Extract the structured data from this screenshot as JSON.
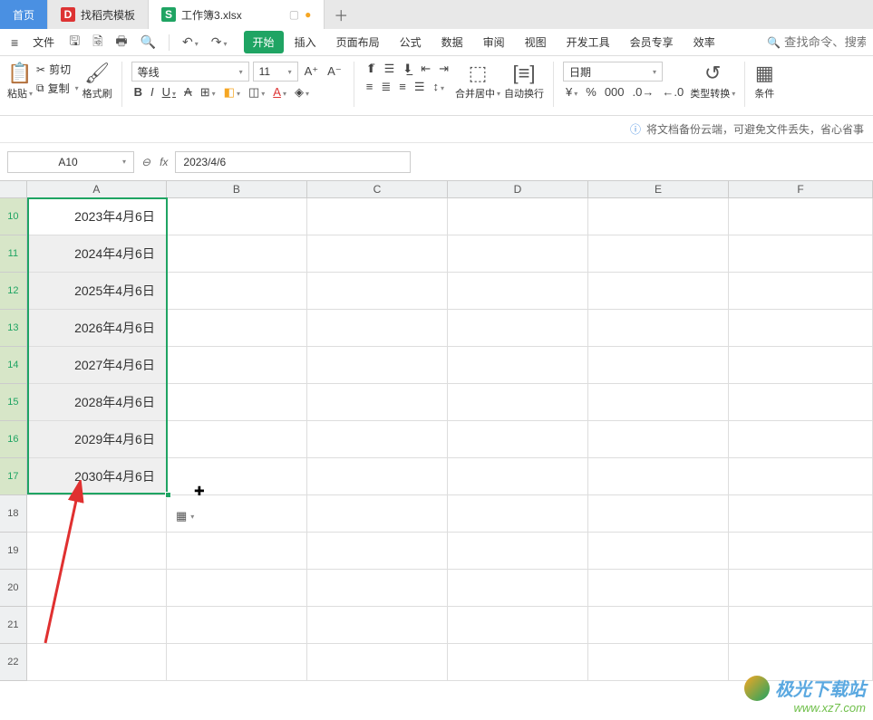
{
  "tabs": {
    "home": "首页",
    "docker_label": "找稻壳模板",
    "workbook_label": "工作簿3.xlsx",
    "docker_icon_glyph": "D",
    "wps_icon_glyph": "S"
  },
  "menubar": {
    "file": "文件",
    "search_placeholder": "查找命令、搜索模",
    "tabs": [
      "开始",
      "插入",
      "页面布局",
      "公式",
      "数据",
      "审阅",
      "视图",
      "开发工具",
      "会员专享",
      "效率"
    ]
  },
  "ribbon": {
    "paste": "粘贴",
    "cut": "剪切",
    "copy": "复制",
    "format_painter": "格式刷",
    "font_name": "等线",
    "font_size": "11",
    "merge_center": "合并居中",
    "wrap_text": "自动换行",
    "number_format": "日期",
    "type_convert": "类型转换",
    "conditional": "条件"
  },
  "cloudbar": {
    "message": "将文档备份云端，可避免文件丢失，省心省事"
  },
  "namebox": "A10",
  "formula_value": "2023/4/6",
  "columns": [
    "A",
    "B",
    "C",
    "D",
    "E",
    "F"
  ],
  "rows": [
    {
      "num": "10",
      "A": "2023年4月6日"
    },
    {
      "num": "11",
      "A": "2024年4月6日"
    },
    {
      "num": "12",
      "A": "2025年4月6日"
    },
    {
      "num": "13",
      "A": "2026年4月6日"
    },
    {
      "num": "14",
      "A": "2027年4月6日"
    },
    {
      "num": "15",
      "A": "2028年4月6日"
    },
    {
      "num": "16",
      "A": "2029年4月6日"
    },
    {
      "num": "17",
      "A": "2030年4月6日"
    },
    {
      "num": "18",
      "A": ""
    },
    {
      "num": "19",
      "A": ""
    },
    {
      "num": "20",
      "A": ""
    },
    {
      "num": "21",
      "A": ""
    },
    {
      "num": "22",
      "A": ""
    }
  ],
  "watermark": {
    "title": "极光下载站",
    "url": "www.xz7.com"
  }
}
